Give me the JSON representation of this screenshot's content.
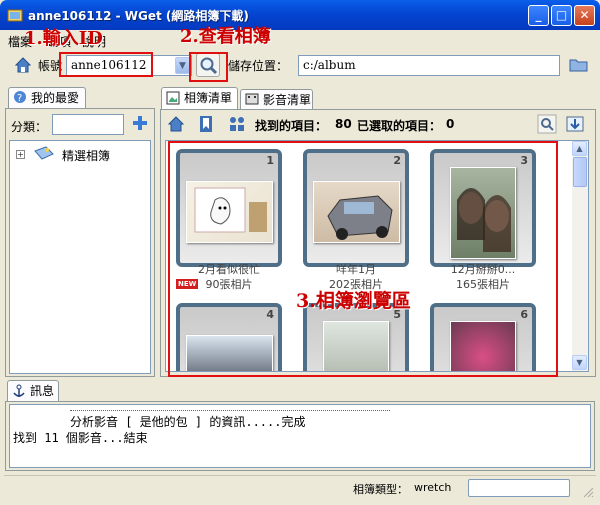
{
  "window": {
    "title": "anne106112 - WGet (網路相簿下載)"
  },
  "menu": {
    "file": "檔案",
    "options": "選項",
    "help": "說明"
  },
  "toolbar": {
    "account_label": "帳號",
    "account_value": "anne106112",
    "save_label": "儲存位置：",
    "save_path": "c:/album"
  },
  "favorites": {
    "tab": "我的最愛",
    "category_label": "分類：",
    "tree_item": "精選相簿"
  },
  "tabs": {
    "albums": "相簿清單",
    "videos": "影音清單"
  },
  "album_toolbar": {
    "found_label": "找到的項目：",
    "found_count": "80",
    "selected_label": "已選取的項目：",
    "selected_count": "0"
  },
  "albums": [
    {
      "num": "1",
      "title": "2月看似很忙",
      "count": "90張相片",
      "new": "NEW"
    },
    {
      "num": "2",
      "title": "咩年1月",
      "count": "202張相片"
    },
    {
      "num": "3",
      "title": "12月掰掰0...",
      "count": "165張相片"
    },
    {
      "num": "4"
    },
    {
      "num": "5"
    },
    {
      "num": "6"
    }
  ],
  "messages": {
    "tab": "訊息",
    "line1": "分析影音 [ 是他的包 ] 的資訊.....完成",
    "line2": "找到 11 個影音...結束"
  },
  "status": {
    "album_type_label": "相簿類型：",
    "album_type": "wretch"
  },
  "annotations": {
    "a1": "1.輸入ID",
    "a2": "2.查看相簿",
    "a3": "3.相簿瀏覽區"
  },
  "colors": {
    "title_bar": "#0545D1",
    "annotation": "#CC0000",
    "card_border": "#4E6F87"
  }
}
